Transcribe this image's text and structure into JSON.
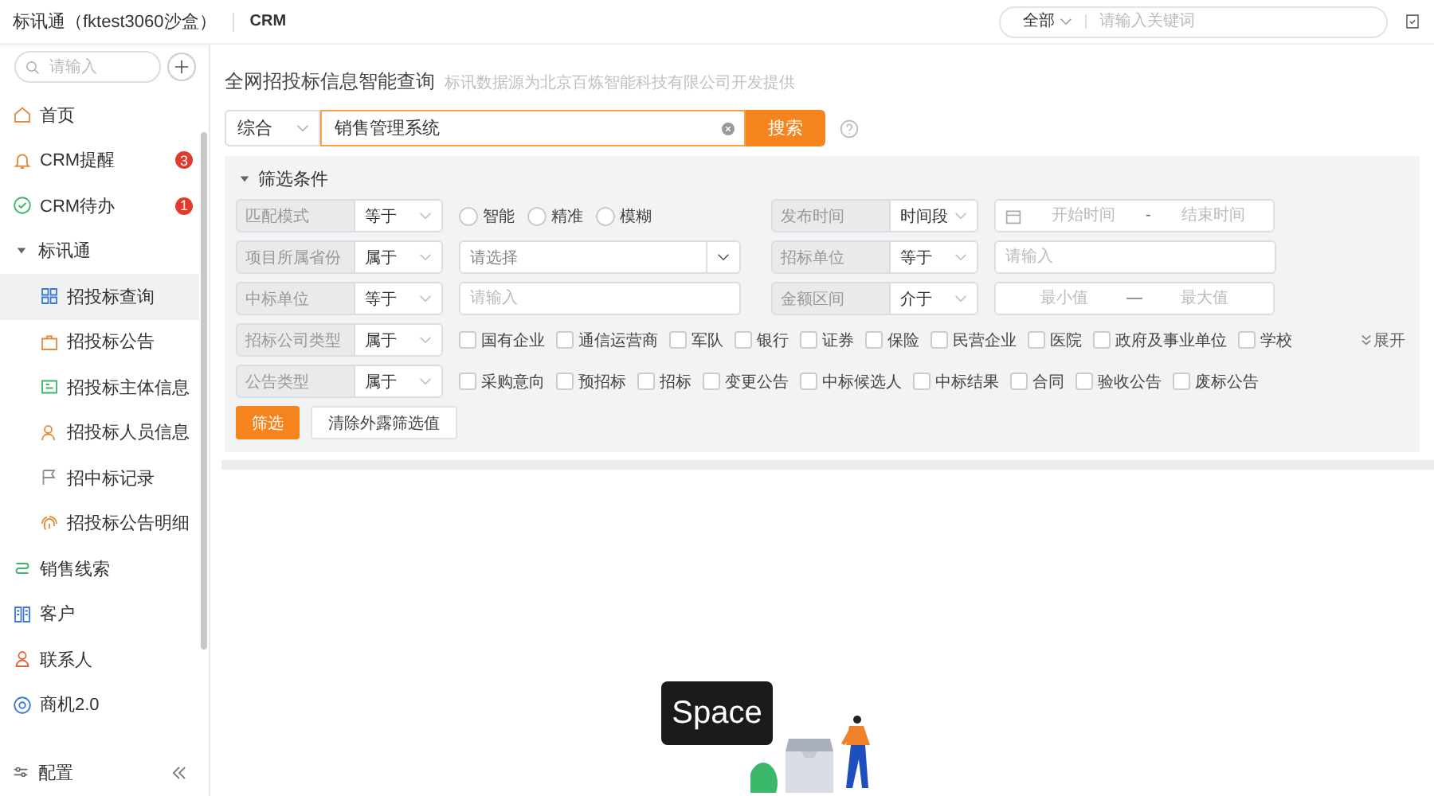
{
  "header": {
    "title": "标讯通（fktest3060沙盒）",
    "module": "CRM",
    "scope": "全部",
    "search_placeholder": "请输入关键词"
  },
  "sidebar": {
    "search_placeholder": "请输入",
    "items": [
      {
        "label": "首页",
        "selected": false
      },
      {
        "label": "CRM提醒",
        "badge": "3",
        "selected": false
      },
      {
        "label": "CRM待办",
        "badge": "1",
        "selected": false
      },
      {
        "label": "标讯通",
        "selected": false,
        "expanded": true,
        "children": [
          {
            "label": "招投标查询",
            "selected": true
          },
          {
            "label": "招投标公告",
            "selected": false
          },
          {
            "label": "招投标主体信息",
            "selected": false
          },
          {
            "label": "招投标人员信息",
            "selected": false
          },
          {
            "label": "招中标记录",
            "selected": false
          },
          {
            "label": "招投标公告明细",
            "selected": false
          }
        ]
      },
      {
        "label": "销售线索",
        "selected": false
      },
      {
        "label": "客户",
        "selected": false
      },
      {
        "label": "联系人",
        "selected": false
      },
      {
        "label": "商机2.0",
        "selected": false
      }
    ],
    "footer": "配置"
  },
  "query": {
    "title": "全网招投标信息智能查询",
    "subtitle": "标讯数据源为北京百炼智能科技有限公司开发提供",
    "category": "综合",
    "keyword": "销售管理系统",
    "search_button": "搜索"
  },
  "filters": {
    "title": "筛选条件",
    "expanded": true,
    "rows": [
      {
        "fields": [
          {
            "label": "匹配模式",
            "operator": "等于",
            "kind": "radio",
            "options": [
              {
                "label": "智能",
                "selected": false
              },
              {
                "label": "精准",
                "selected": false
              },
              {
                "label": "模糊",
                "selected": false
              }
            ]
          },
          {
            "label": "发布时间",
            "operator": "时间段",
            "kind": "date_range",
            "from_placeholder": "开始时间",
            "separator": "-",
            "to_placeholder": "结束时间"
          }
        ]
      },
      {
        "fields": [
          {
            "label": "项目所属省份",
            "operator": "属于",
            "kind": "select",
            "placeholder": "请选择"
          },
          {
            "label": "招标单位",
            "operator": "等于",
            "kind": "input",
            "placeholder": "请输入"
          }
        ]
      },
      {
        "fields": [
          {
            "label": "中标单位",
            "operator": "等于",
            "kind": "input",
            "placeholder": "请输入"
          },
          {
            "label": "金额区间",
            "operator": "介于",
            "kind": "number_range",
            "from_placeholder": "最小值",
            "separator": "—",
            "to_placeholder": "最大值"
          }
        ]
      },
      {
        "fields": [
          {
            "label": "招标公司类型",
            "operator": "属于",
            "kind": "checkboxes",
            "options": [
              {
                "label": "国有企业",
                "checked": false
              },
              {
                "label": "通信运营商",
                "checked": false
              },
              {
                "label": "军队",
                "checked": false
              },
              {
                "label": "银行",
                "checked": false
              },
              {
                "label": "证券",
                "checked": false
              },
              {
                "label": "保险",
                "checked": false
              },
              {
                "label": "民营企业",
                "checked": false
              },
              {
                "label": "医院",
                "checked": false
              },
              {
                "label": "政府及事业单位",
                "checked": false
              },
              {
                "label": "学校",
                "checked": false
              }
            ]
          }
        ],
        "more_link": "展开"
      },
      {
        "fields": [
          {
            "label": "公告类型",
            "operator": "属于",
            "kind": "checkboxes",
            "options": [
              {
                "label": "采购意向",
                "checked": false
              },
              {
                "label": "预招标",
                "checked": false
              },
              {
                "label": "招标",
                "checked": false
              },
              {
                "label": "变更公告",
                "checked": false
              },
              {
                "label": "中标候选人",
                "checked": false
              },
              {
                "label": "中标结果",
                "checked": false
              },
              {
                "label": "合同",
                "checked": false
              },
              {
                "label": "验收公告",
                "checked": false
              },
              {
                "label": "废标公告",
                "checked": false
              }
            ]
          }
        ]
      }
    ],
    "apply_button": "筛选",
    "clear_button": "清除外露筛选值"
  },
  "key_overlay": "Space"
}
